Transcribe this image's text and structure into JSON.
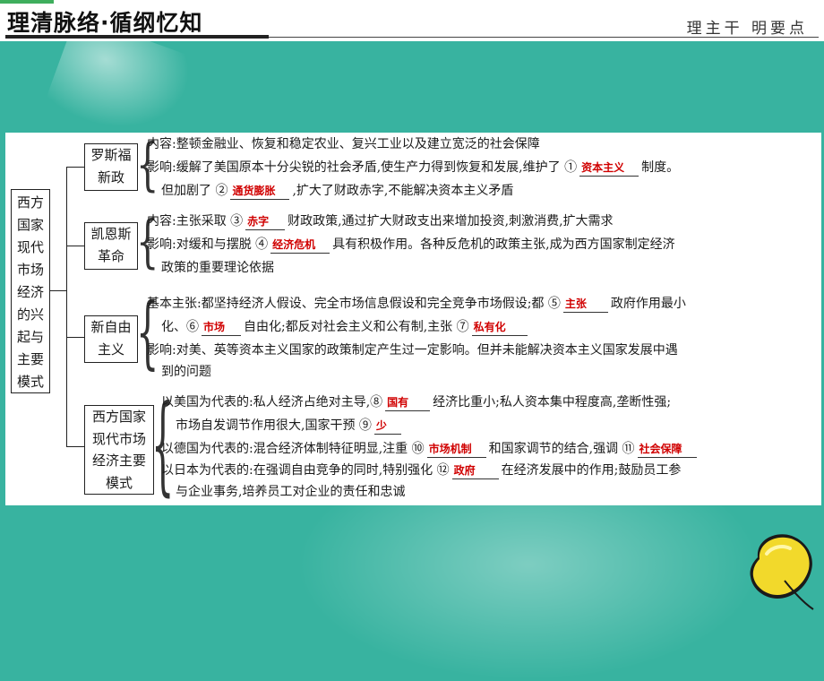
{
  "header": {
    "title": "理清脉络·循纲忆知",
    "subtitle": "理主干 明要点"
  },
  "outline": {
    "root": "西方国家现代市场经济的兴起与主要模式",
    "roosevelt": {
      "label": "罗斯福新政",
      "content": "内容:整顿金融业、恢复和稳定农业、复兴工业以及建立宽泛的社会保障",
      "impact_a": "影响:缓解了美国原本十分尖锐的社会矛盾,使生产力得到恢复和发展,维护了 ①",
      "impact_b": "制度。",
      "impact_c": "但加剧了 ②",
      "impact_d": ",扩大了财政赤字,不能解决资本主义矛盾",
      "blank1": "资本主义",
      "blank2": "通货膨胀"
    },
    "keynes": {
      "label": "凯恩斯革命",
      "content_a": "内容:主张采取 ③",
      "content_b": "财政政策,通过扩大财政支出来增加投资,刺激消费,扩大需求",
      "impact_a": "影响:对缓和与摆脱 ④",
      "impact_b": "具有积极作用。各种反危机的政策主张,成为西方国家制定经济",
      "impact_c": "政策的重要理论依据",
      "blank3": "赤字",
      "blank4": "经济危机"
    },
    "neoliberal": {
      "label": "新自由主义",
      "basic_a": "基本主张:都坚持经济人假设、完全市场信息假设和完全竞争市场假设;都 ⑤",
      "basic_b": "政府作用最小",
      "basic_c": "化、⑥",
      "basic_d": "自由化;都反对社会主义和公有制,主张 ⑦",
      "impact_a": "影响:对美、英等资本主义国家的政策制定产生过一定影响。但并未能解决资本主义国家发展中遇",
      "impact_b": "到的问题",
      "blank5": "主张",
      "blank6": "市场",
      "blank7": "私有化"
    },
    "models": {
      "label": "西方国家现代市场经济主要模式",
      "us_a": "以美国为代表的:私人经济占绝对主导,⑧",
      "us_b": "经济比重小;私人资本集中程度高,垄断性强;",
      "us_c": "市场自发调节作用很大,国家干预 ⑨",
      "de_a": "以德国为代表的:混合经济体制特征明显,注重 ⑩",
      "de_b": "和国家调节的结合,强调 ⑪",
      "jp_a": "以日本为代表的:在强调自由竞争的同时,特别强化 ⑫",
      "jp_b": "在经济发展中的作用;鼓励员工参",
      "jp_c": "与企业事务,培养员工对企业的责任和忠诚",
      "blank8": "国有",
      "blank9": "少",
      "blank10": "市场机制",
      "blank11": "社会保障",
      "blank12": "政府"
    }
  },
  "colors": {
    "background": "#38b3a0",
    "answer": "#d00000"
  }
}
